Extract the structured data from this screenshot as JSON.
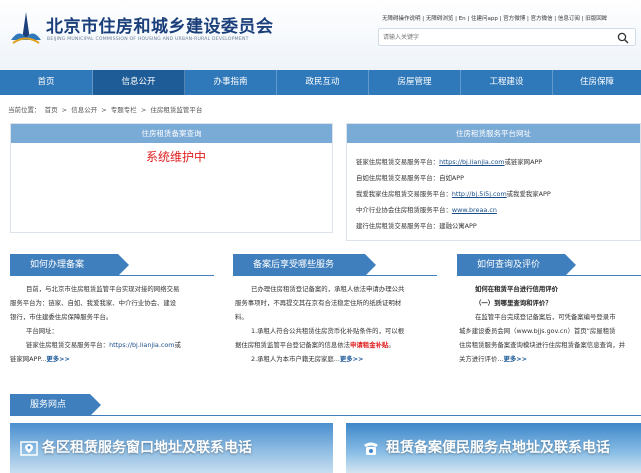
{
  "header": {
    "title": "北京市住房和城乡建设委员会",
    "subtitle": "BEIJING MUNICIPAL COMMISSION OF HOUSING AND URBAN-RURAL DEVELOPMENT",
    "top_links": "无障碍操作说明 | 无障碍浏览 | En | 住建问app | 官方微博 | 官方微信 | 信息订阅 | 旧版回眸",
    "search_placeholder": "请输入关键字"
  },
  "nav": {
    "items": [
      {
        "label": "首页"
      },
      {
        "label": "信息公开"
      },
      {
        "label": "办事指南"
      },
      {
        "label": "政民互动"
      },
      {
        "label": "房屋管理"
      },
      {
        "label": "工程建设"
      },
      {
        "label": "住房保障"
      }
    ]
  },
  "breadcrumb": {
    "prefix": "当前位置：",
    "items": [
      "首页",
      "信息公开",
      "专题专栏",
      "住房租赁监管平台"
    ],
    "sep": ">"
  },
  "query_panel": {
    "title": "住房租赁备案查询",
    "status": "系统维护中"
  },
  "platform_panel": {
    "title": "住房租赁服务平台网址",
    "rows": [
      {
        "prefix": "链家住房租赁交易服务平台：",
        "link": "https://bj.lianjia.com",
        "suffix": "或链家网APP"
      },
      {
        "prefix": "自如住房租赁交易服务平台：自如APP",
        "link": "",
        "suffix": ""
      },
      {
        "prefix": "我爱我家住房租赁交易服务平台：",
        "link": "http://bj.5i5j.com",
        "suffix": "或我爱我家APP"
      },
      {
        "prefix": "中介行业协会住房租赁服务平台：",
        "link": "www.breaa.cn",
        "suffix": ""
      },
      {
        "prefix": "建行住房租赁交易服务平台：建融公寓APP",
        "link": "",
        "suffix": ""
      }
    ]
  },
  "sections": {
    "s1": {
      "title": "如何办理备案",
      "p1": "目前，与北京市住房租赁监管平台实现对接的网络交易",
      "p2": "服务平台为：链家、自如、我爱我家、中介行业协会、建设",
      "p3": "银行，市住建委住房保障服务平台。",
      "p4": "平台网址：",
      "p5a": "链家住房租赁交易服务平台：",
      "p5b": "https://bj.lianjia.com",
      "p5c": "或",
      "p6": "链家网APP...",
      "more": "更多>>"
    },
    "s2": {
      "title": "备案后享受哪些服务",
      "p1": "已办理住房租赁登记备案的，承租人依法申请办理公共",
      "p2": "服务事项时，不再提交其在京有合法稳定住所的纸质证明材",
      "p3": "料。",
      "p4": "1.承租人符合公共租赁住房货币化补贴条件的，可以根",
      "p5a": "据住房租赁监管平台登记备案的信息依法",
      "p5b": "申请租金补贴",
      "p5c": "。",
      "p6": "2.承租人为本市户籍无房家庭...",
      "more": "更多>>"
    },
    "s3": {
      "title": "如何查询及评价",
      "p1": "如何在租赁平台进行信用评价",
      "p2": "（一）到哪里查询和评价？",
      "p3": "在监管平台完成登记备案后，可凭备案编号登录市",
      "p4": "城乡建设委员会网（www.bjjs.gov.cn）首页“房屋租赁",
      "p5": "住房租赁服务备案查询模块进行住房租赁备案信息查询，并",
      "p6": "关方进行评价...",
      "more": "更多>>"
    },
    "service": {
      "title": "服务网点"
    }
  },
  "banners": {
    "left": "各区租赁服务窗口地址及联系电话",
    "right": "租赁备案便民服务点地址及联系电话"
  },
  "colors": {
    "nav": "#2f78b9",
    "nav_active": "#1e5c97",
    "panel_head": "#7aaad6",
    "section": "#3f7fbd",
    "alert": "#e02020"
  }
}
